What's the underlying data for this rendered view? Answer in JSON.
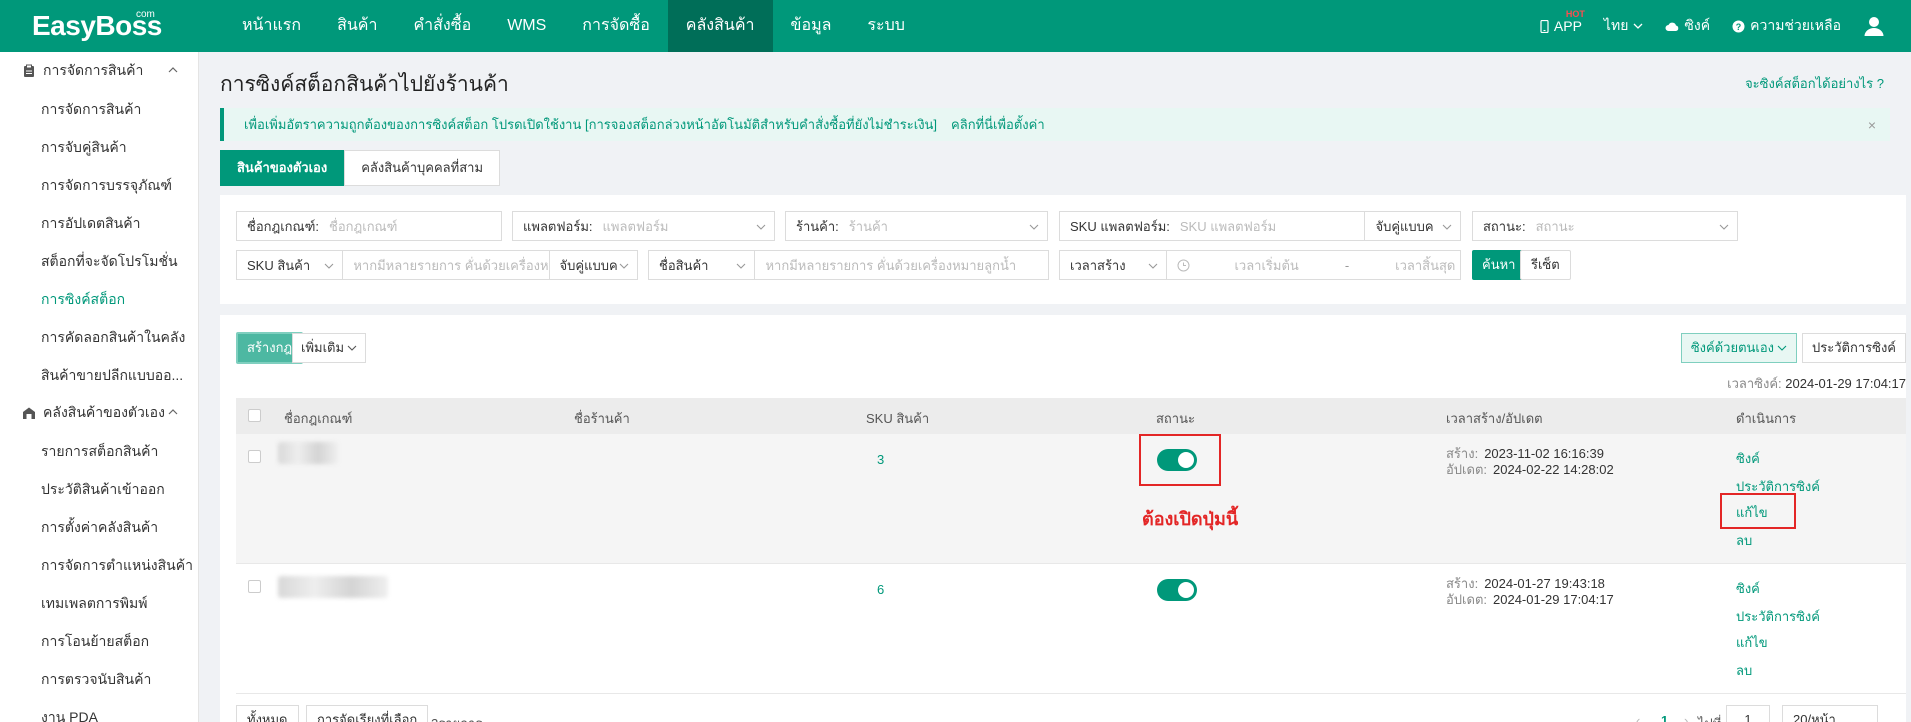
{
  "brand": {
    "logo": "EasyBoss",
    "logo_suffix": "com"
  },
  "nav": {
    "items": [
      "หน้าแรก",
      "สินค้า",
      "คำสั่งซื้อ",
      "WMS",
      "การจัดซื้อ",
      "คลังสินค้า",
      "ข้อมูล",
      "ระบบ"
    ],
    "active_index": 5,
    "app_label": "APP",
    "hot_badge": "HOT",
    "language": "ไทย",
    "sync": "ซิงค์",
    "help": "ความช่วยเหลือ"
  },
  "sidebar": {
    "group1": {
      "label": "การจัดการสินค้า",
      "items": [
        "การจัดการสินค้า",
        "การจับคู่สินค้า",
        "การจัดการบรรจุภัณฑ์",
        "การอัปเดตสินค้า",
        "สต็อกที่จะจัดโปรโมชั่น",
        "การซิงค์สต็อก",
        "การคัดลอกสินค้าในคลัง",
        "สินค้าขายปลีกแบบออ..."
      ],
      "active_index": 5
    },
    "group2": {
      "label": "คลังสินค้าของตัวเอง",
      "items": [
        "รายการสต็อกสินค้า",
        "ประวัติสินค้าเข้าออก",
        "การตั้งค่าคลังสินค้า",
        "การจัดการตำแหน่งสินค้า",
        "เทมเพลตการพิมพ์",
        "การโอนย้ายสต็อก",
        "การตรวจนับสินค้า",
        "งาน PDA"
      ]
    }
  },
  "page": {
    "title": "การซิงค์สต็อกสินค้าไปยังร้านค้า",
    "help_link": "จะซิงค์สต็อกได้อย่างไร ?",
    "alert": "เพื่อเพิ่มอัตราความถูกต้องของการซิงค์สต็อก โปรดเปิดใช้งาน [การจองสต็อกล่วงหน้าอัตโนมัติสำหรับคำสั่งซื้อที่ยังไม่ชำระเงิน]",
    "alert_link": "คลิกที่นี่เพื่อตั้งค่า",
    "alert_close": "×",
    "tabs": [
      "สินค้าของตัวเอง",
      "คลังสินค้าบุคคลที่สาม"
    ]
  },
  "filters": {
    "rule_name": {
      "label": "ชื่อกฎเกณฑ์:",
      "placeholder": "ชื่อกฎเกณฑ์"
    },
    "platform": {
      "label": "แพลตฟอร์ม:",
      "placeholder": "แพลตฟอร์ม"
    },
    "shop": {
      "label": "ร้านค้า:",
      "placeholder": "ร้านค้า"
    },
    "platform_sku": {
      "label": "SKU แพลตฟอร์ม:",
      "placeholder": "SKU แพลตฟอร์ม",
      "match": "จับคู่แบบค"
    },
    "status": {
      "label": "สถานะ:",
      "placeholder": "สถานะ"
    },
    "sku": {
      "select": "SKU สินค้า",
      "placeholder": "หากมีหลายรายการ คั่นด้วยเครื่องห",
      "match": "จับคู่แบบค"
    },
    "product_name": {
      "select": "ชื่อสินค้า",
      "placeholder": "หากมีหลายรายการ คั่นด้วยเครื่องหมายลูกน้ำ"
    },
    "time": {
      "select": "เวลาสร้าง",
      "start": "เวลาเริ่มต้น",
      "sep": "-",
      "end": "เวลาสิ้นสุด"
    },
    "search_btn": "ค้นหา",
    "reset_btn": "รีเซ็ต"
  },
  "list": {
    "create_btn": "สร้างกฎ",
    "more_btn": "เพิ่มเติม",
    "manual_sync_btn": "ซิงค์ด้วยตนเอง",
    "history_btn": "ประวัติการซิงค์",
    "sync_time_label": "เวลาซิงค์:",
    "sync_time_value": "2024-01-29 17:04:17",
    "columns": [
      "ชื่อกฎเกณฑ์",
      "ชื่อร้านค้า",
      "SKU สินค้า",
      "สถานะ",
      "เวลาสร้าง/อัปเดต",
      "ดำเนินการ"
    ],
    "rows": [
      {
        "sku_count": "3",
        "status_on": true,
        "created_label": "สร้าง:",
        "created": "2023-11-02 16:16:39",
        "updated_label": "อัปเดต:",
        "updated": "2024-02-22 14:28:02",
        "actions": [
          "ซิงค์",
          "ประวัติการซิงค์",
          "แก้ไข",
          "ลบ"
        ]
      },
      {
        "sku_count": "6",
        "status_on": true,
        "created_label": "สร้าง:",
        "created": "2024-01-27 19:43:18",
        "updated_label": "อัปเดต:",
        "updated": "2024-01-29 17:04:17",
        "actions": [
          "ซิงค์",
          "ประวัติการซิงค์",
          "แก้ไข",
          "ลบ"
        ]
      }
    ],
    "annotation": "ต้องเปิดปุ่มนี้",
    "pager": {
      "all": "ทั้งหมด",
      "selected": "การจัดเรียงที่เลือก",
      "count": "2รายการ",
      "page": "1",
      "goto": "ไปที่",
      "goto_value": "1",
      "page_size": "20/หน้า"
    }
  },
  "colors": {
    "brand": "#00987a",
    "annotation": "#e32626"
  }
}
